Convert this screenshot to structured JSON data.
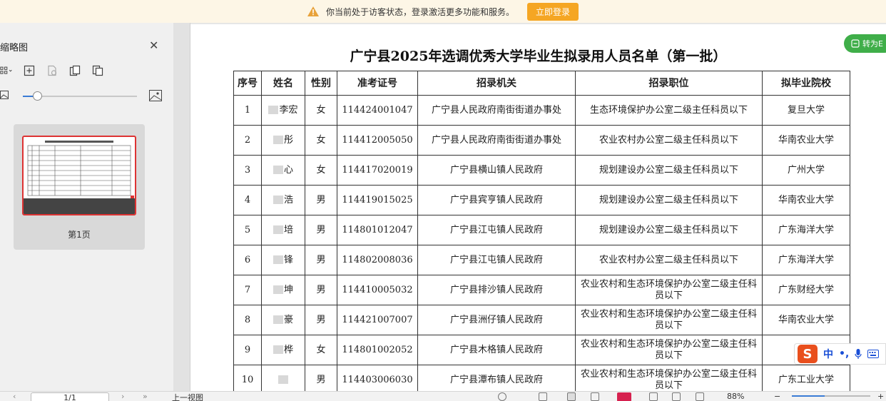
{
  "notice": {
    "message": "你当前处于访客状态，登录激活更多功能和服务。",
    "login_label": "立即登录"
  },
  "sidebar": {
    "title": "缩略图",
    "thumbnail_label": "第1页",
    "thumbnail_zoom_level": 0.13
  },
  "document": {
    "title": "广宁县2025年选调优秀大学毕业生拟录用人员名单（第一批）",
    "headers": [
      "序号",
      "姓名",
      "性别",
      "准考证号",
      "招录机关",
      "招录职位",
      "拟毕业院校"
    ],
    "rows": [
      {
        "no": "1",
        "name": "李宏",
        "gender": "女",
        "id": "114424001047",
        "agency": "广宁县人民政府南街街道办事处",
        "position": "生态环境保护办公室二级主任科员以下",
        "school": "复旦大学"
      },
      {
        "no": "2",
        "name": "彤",
        "gender": "女",
        "id": "114412005050",
        "agency": "广宁县人民政府南街街道办事处",
        "position": "农业农村办公室二级主任科员以下",
        "school": "华南农业大学"
      },
      {
        "no": "3",
        "name": "心",
        "gender": "女",
        "id": "114417020019",
        "agency": "广宁县横山镇人民政府",
        "position": "规划建设办公室二级主任科员以下",
        "school": "广州大学"
      },
      {
        "no": "4",
        "name": "浩",
        "gender": "男",
        "id": "114419015025",
        "agency": "广宁县宾亨镇人民政府",
        "position": "规划建设办公室二级主任科员以下",
        "school": "华南农业大学"
      },
      {
        "no": "5",
        "name": "培",
        "gender": "男",
        "id": "114801012047",
        "agency": "广宁县江屯镇人民政府",
        "position": "规划建设办公室二级主任科员以下",
        "school": "广东海洋大学"
      },
      {
        "no": "6",
        "name": "锋",
        "gender": "男",
        "id": "114802008036",
        "agency": "广宁县江屯镇人民政府",
        "position": "农业农村办公室二级主任科员以下",
        "school": "广东海洋大学"
      },
      {
        "no": "7",
        "name": "坤",
        "gender": "男",
        "id": "114410005032",
        "agency": "广宁县排沙镇人民政府",
        "position": "农业农村和生态环境保护办公室二级主任科员以下",
        "school": "广东财经大学"
      },
      {
        "no": "8",
        "name": "豪",
        "gender": "男",
        "id": "114421007007",
        "agency": "广宁县洲仔镇人民政府",
        "position": "农业农村和生态环境保护办公室二级主任科员以下",
        "school": "华南农业大学"
      },
      {
        "no": "9",
        "name": "桦",
        "gender": "女",
        "id": "114801002052",
        "agency": "广宁县木格镇人民政府",
        "position": "农业农村和生态环境保护办公室二级主任科员以下",
        "school": "广东"
      },
      {
        "no": "10",
        "name": "",
        "gender": "男",
        "id": "114403006030",
        "agency": "广宁县潭布镇人民政府",
        "position": "农业农村和生态环境保护办公室二级主任科员以下",
        "school": "广东工业大学"
      }
    ]
  },
  "convert_button": {
    "label": "转为E"
  },
  "ime": {
    "logo": "S",
    "lang": "中",
    "punct": "•,"
  },
  "status_bar": {
    "page_indicator": "1/1",
    "prev_view_label": "上一视图",
    "zoom": "88%",
    "zoom_level": 0.42
  },
  "colors": {
    "accent": "#f5a623",
    "convert": "#3fae49",
    "thumb_border": "#dd3333",
    "ime_logo": "#e94f1d"
  }
}
